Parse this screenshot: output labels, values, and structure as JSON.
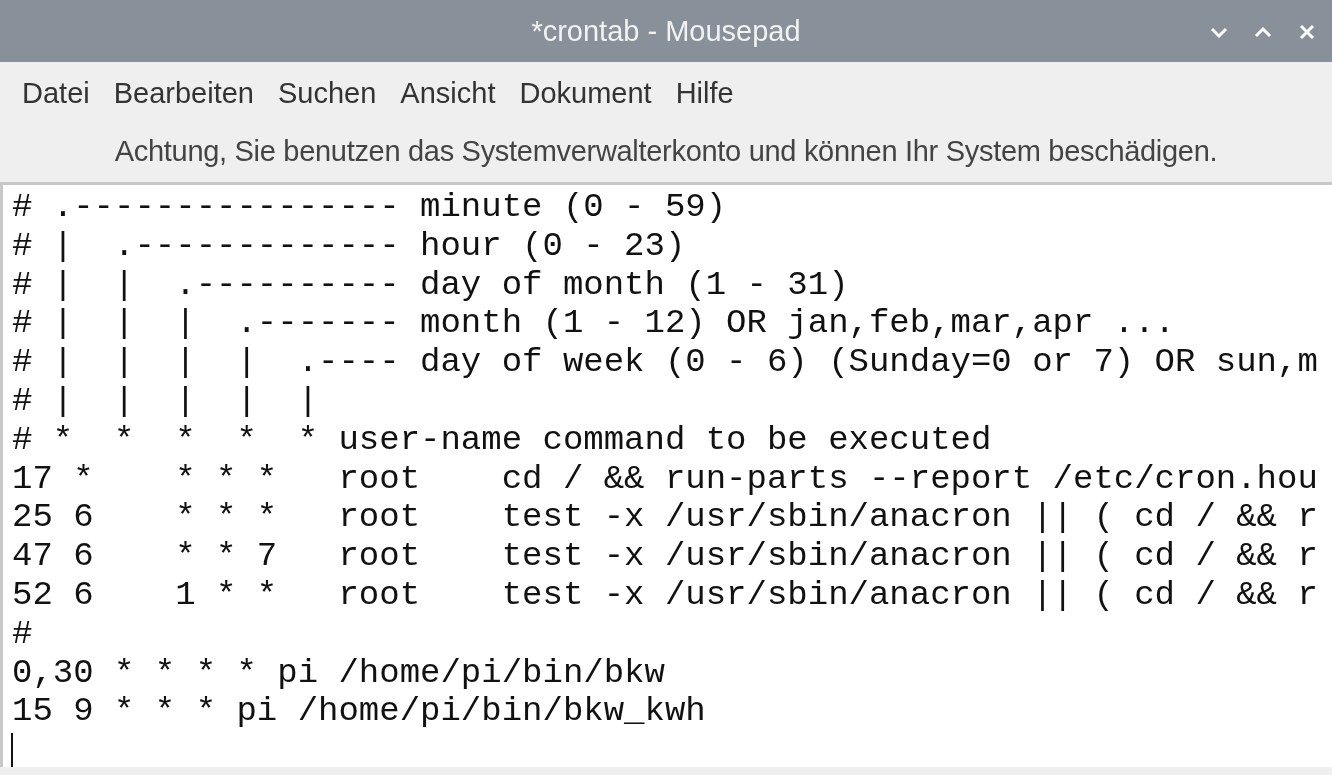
{
  "window": {
    "title": "*crontab - Mousepad"
  },
  "menu": [
    "Datei",
    "Bearbeiten",
    "Suchen",
    "Ansicht",
    "Dokument",
    "Hilfe"
  ],
  "warning": "Achtung, Sie benutzen das Systemverwalterkonto und können Ihr System beschädigen.",
  "editor": {
    "lines": [
      "# .---------------- minute (0 - 59)",
      "# |  .------------- hour (0 - 23)",
      "# |  |  .---------- day of month (1 - 31)",
      "# |  |  |  .------- month (1 - 12) OR jan,feb,mar,apr ...",
      "# |  |  |  |  .---- day of week (0 - 6) (Sunday=0 or 7) OR sun,m",
      "# |  |  |  |  |",
      "# *  *  *  *  * user-name command to be executed",
      "17 *    * * *   root    cd / && run-parts --report /etc/cron.hou",
      "25 6    * * *   root    test -x /usr/sbin/anacron || ( cd / && r",
      "47 6    * * 7   root    test -x /usr/sbin/anacron || ( cd / && r",
      "52 6    1 * *   root    test -x /usr/sbin/anacron || ( cd / && r",
      "#",
      "0,30 * * * * pi /home/pi/bin/bkw",
      "15 9 * * * pi /home/pi/bin/bkw_kwh"
    ]
  }
}
